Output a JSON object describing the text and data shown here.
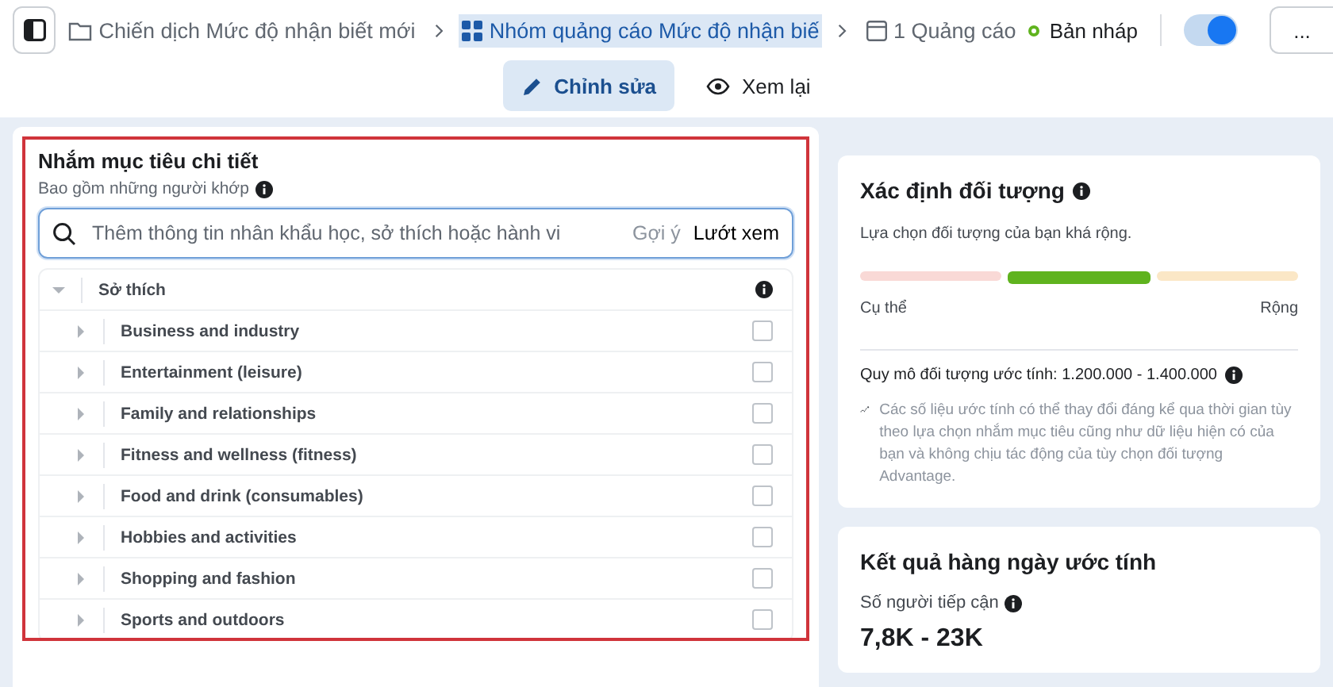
{
  "breadcrumbs": [
    {
      "kind": "campaign",
      "label": "Chiến dịch Mức độ nhận biết mới",
      "selected": false
    },
    {
      "kind": "adset",
      "label": "Nhóm quảng cáo Mức độ nhận biế",
      "selected": true
    },
    {
      "kind": "ad",
      "label": "1 Quảng cáo",
      "selected": false
    }
  ],
  "status": {
    "label": "Bản nháp",
    "toggle_on": true
  },
  "more_button": "...",
  "mode_tabs": [
    {
      "kind": "edit",
      "label": "Chỉnh sửa",
      "selected": true
    },
    {
      "kind": "review",
      "label": "Xem lại",
      "selected": false
    }
  ],
  "targeting": {
    "title": "Nhắm mục tiêu chi tiết",
    "subtitle": "Bao gồm những người khớp",
    "highlighted": true,
    "search": {
      "placeholder": "Thêm thông tin nhân khẩu học, sở thích hoặc hành vi",
      "suggest": "Gợi ý",
      "browse": "Lướt xem"
    },
    "category": {
      "label": "Sở thích",
      "expanded": true,
      "children": [
        {
          "label": "Business and industry",
          "checked": false,
          "expanded": false
        },
        {
          "label": "Entertainment (leisure)",
          "checked": false,
          "expanded": false
        },
        {
          "label": "Family and relationships",
          "checked": false,
          "expanded": false
        },
        {
          "label": "Fitness and wellness (fitness)",
          "checked": false,
          "expanded": false
        },
        {
          "label": "Food and drink (consumables)",
          "checked": false,
          "expanded": false
        },
        {
          "label": "Hobbies and activities",
          "checked": false,
          "expanded": false
        },
        {
          "label": "Shopping and fashion",
          "checked": false,
          "expanded": false
        },
        {
          "label": "Sports and outdoors",
          "checked": false,
          "expanded": false
        }
      ]
    }
  },
  "audience": {
    "title": "Xác định đối tượng",
    "description": "Lựa chọn đối tượng của bạn khá rộng.",
    "segments": [
      {
        "selected": false,
        "color": "#f9d9d6"
      },
      {
        "selected": true,
        "color": "#5fb31e"
      },
      {
        "selected": false,
        "color": "#fbe7c6"
      }
    ],
    "min_label": "Cụ thể",
    "max_label": "Rộng",
    "size": "Quy mô đối tượng ước tính: 1.200.000 - 1.400.000",
    "note": "Các số liệu ước tính có thể thay đổi đáng kể qua thời gian tùy theo lựa chọn nhắm mục tiêu cũng như dữ liệu hiện có của bạn và không chịu tác động của tùy chọn đối tượng Advantage."
  },
  "daily_results": {
    "title": "Kết quả hàng ngày ước tính",
    "reach_label": "Số người tiếp cận",
    "reach_value": "7,8K - 23K"
  }
}
